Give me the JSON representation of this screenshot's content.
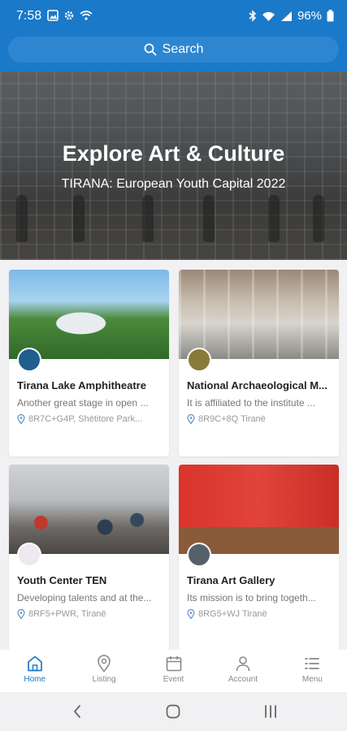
{
  "status": {
    "time": "7:58",
    "battery": "96%"
  },
  "search": {
    "label": "Search"
  },
  "hero": {
    "title": "Explore Art & Culture",
    "subtitle": "TIRANA: European Youth Capital 2022"
  },
  "places": [
    {
      "name": "Tirana Lake Amphitheatre",
      "description": "Another great stage in open ...",
      "location": "8R7C+G4P, Shëtitore Park..."
    },
    {
      "name": "National Archaeological M...",
      "description": "It is affiliated to the institute ...",
      "location": "8R9C+8Q Tiranë"
    },
    {
      "name": "Youth Center TEN",
      "description": "Developing talents and at the...",
      "location": "8RF5+PWR, Tiranë"
    },
    {
      "name": "Tirana Art Gallery",
      "description": "Its mission is to bring togeth...",
      "location": "8RG5+WJ Tiranë"
    }
  ],
  "bottom_nav": [
    {
      "label": "Home",
      "icon": "home-icon",
      "active": true
    },
    {
      "label": "Listing",
      "icon": "map-pin-icon",
      "active": false
    },
    {
      "label": "Event",
      "icon": "calendar-icon",
      "active": false
    },
    {
      "label": "Account",
      "icon": "person-icon",
      "active": false
    },
    {
      "label": "Menu",
      "icon": "menu-list-icon",
      "active": false
    }
  ],
  "colors": {
    "primary": "#1a79c9",
    "background": "#f1f1f3"
  }
}
